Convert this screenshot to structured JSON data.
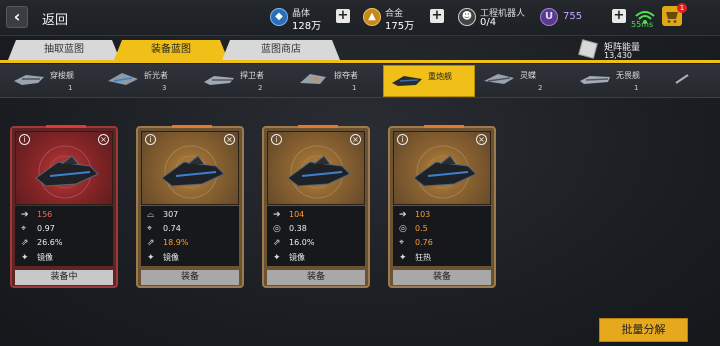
{
  "header": {
    "back_label": "返回",
    "resources": [
      {
        "icon": "crystal-icon",
        "name": "晶体",
        "value": "128万"
      },
      {
        "icon": "alloy-icon",
        "name": "合金",
        "value": "175万"
      },
      {
        "icon": "robot-icon",
        "name": "工程机器人",
        "value": "0/4"
      }
    ],
    "u_currency": {
      "icon": "u-coin-icon",
      "symbol": "U",
      "value": "755"
    },
    "ping": "55ms",
    "cart_badge": "1"
  },
  "tabs": [
    {
      "label": "抽取蓝图",
      "active": false
    },
    {
      "label": "装备蓝图",
      "active": true
    },
    {
      "label": "蓝图商店",
      "active": false
    }
  ],
  "matrix_energy": {
    "label": "矩阵能量",
    "value": "13,430"
  },
  "ship_types": [
    {
      "name": "穿梭舰",
      "count": "1",
      "active": false
    },
    {
      "name": "折光者",
      "count": "3",
      "active": false
    },
    {
      "name": "捍卫者",
      "count": "2",
      "active": false
    },
    {
      "name": "掠夺者",
      "count": "1",
      "active": false
    },
    {
      "name": "重炮舰",
      "count": "",
      "active": true
    },
    {
      "name": "灵蝶",
      "count": "2",
      "active": false
    },
    {
      "name": "无畏舰",
      "count": "1",
      "active": false
    }
  ],
  "cards": [
    {
      "theme": "red",
      "stats": [
        {
          "icon": "arrow-icon",
          "value": "156",
          "color": "#ff6060"
        },
        {
          "icon": "crosshair-icon",
          "value": "0.97",
          "color": "#eeeeee"
        },
        {
          "icon": "missile-icon",
          "value": "26.6%",
          "color": "#eeeeee"
        },
        {
          "icon": "skill-icon",
          "value": "镜像",
          "color": "#eeeeee"
        }
      ],
      "action": "装备中"
    },
    {
      "theme": "orange",
      "stats": [
        {
          "icon": "shield-icon",
          "value": "307",
          "color": "#eeeeee"
        },
        {
          "icon": "crosshair-icon",
          "value": "0.74",
          "color": "#eeeeee"
        },
        {
          "icon": "missile-icon",
          "value": "18.9%",
          "color": "#ff9a30"
        },
        {
          "icon": "skill-icon",
          "value": "镜像",
          "color": "#eeeeee"
        }
      ],
      "action": "装备"
    },
    {
      "theme": "orange",
      "stats": [
        {
          "icon": "arrow-icon",
          "value": "104",
          "color": "#ff9a30"
        },
        {
          "icon": "target-icon",
          "value": "0.38",
          "color": "#eeeeee"
        },
        {
          "icon": "missile-icon",
          "value": "16.0%",
          "color": "#eeeeee"
        },
        {
          "icon": "skill-icon",
          "value": "镜像",
          "color": "#eeeeee"
        }
      ],
      "action": "装备"
    },
    {
      "theme": "orange",
      "stats": [
        {
          "icon": "arrow-icon",
          "value": "103",
          "color": "#ff9a30"
        },
        {
          "icon": "target-icon",
          "value": "0.5",
          "color": "#ff9a30"
        },
        {
          "icon": "crosshair-icon",
          "value": "0.76",
          "color": "#ff9a30"
        },
        {
          "icon": "skill-icon",
          "value": "狂热",
          "color": "#eeeeee"
        }
      ],
      "action": "装备"
    }
  ],
  "bulk_button": "批量分解"
}
